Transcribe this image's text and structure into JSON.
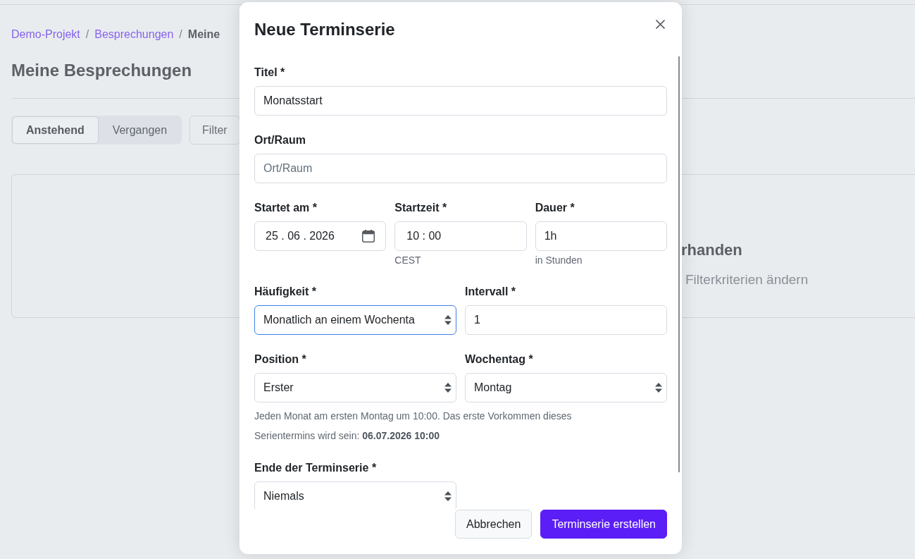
{
  "page": {
    "breadcrumb": [
      {
        "kind": "link",
        "label": "Demo-Projekt"
      },
      {
        "kind": "separator",
        "label": "/"
      },
      {
        "kind": "link",
        "label": "Besprechungen"
      },
      {
        "kind": "separator",
        "label": "/"
      },
      {
        "kind": "current",
        "label": "Meine"
      }
    ],
    "title": "Meine Besprechungen",
    "tabs": [
      {
        "label": "Anstehend",
        "selected": true
      },
      {
        "label": "Vergangen",
        "selected": false
      }
    ],
    "filter_button": "Filter",
    "empty_state": {
      "heading": "rhanden",
      "hint": "Filterkriterien ändern"
    }
  },
  "dialog": {
    "title": "Neue Terminserie",
    "sections": [
      {
        "kind": "full",
        "fields": [
          {
            "kind": "text",
            "label": "Titel *",
            "value": "Monatsstart",
            "focused": false
          }
        ]
      },
      {
        "kind": "full",
        "fields": [
          {
            "kind": "text",
            "label": "Ort/Raum",
            "placeholder": "Ort/Raum",
            "focused": false
          }
        ]
      },
      {
        "kind": "thirds",
        "fields": [
          {
            "kind": "date",
            "label": "Startet am *",
            "value": "25 . 06 . 2026",
            "focused": false
          },
          {
            "kind": "time",
            "label": "Startzeit *",
            "value": "10 : 00",
            "help": "CEST",
            "focused": false
          },
          {
            "kind": "text",
            "label": "Dauer *",
            "value": "1h",
            "help": "in Stunden",
            "focused": false
          }
        ]
      },
      {
        "kind": "halves",
        "fields": [
          {
            "kind": "select",
            "label": "Häufigkeit *",
            "value": "Monatlich an einem Wochenta",
            "focused": true
          },
          {
            "kind": "text",
            "label": "Intervall *",
            "value": "1",
            "focused": false
          }
        ]
      },
      {
        "kind": "halves",
        "fields": [
          {
            "kind": "select",
            "label": "Position *",
            "value": "Erster",
            "focused": false
          },
          {
            "kind": "select",
            "label": "Wochentag *",
            "value": "Montag",
            "focused": false
          }
        ]
      },
      {
        "kind": "note",
        "text": "Jeden Monat am ersten Montag um 10:00. Das erste Vorkommen dieses Serientermins wird sein: **06.07.2026 10:00**"
      },
      {
        "kind": "halves",
        "fields": [
          {
            "kind": "select",
            "label": "Ende der Terminserie *",
            "value": "Niemals",
            "focused": false
          }
        ]
      }
    ],
    "buttons": [
      {
        "label": "Abbrechen",
        "kind": "secondary"
      },
      {
        "label": "Terminserie erstellen",
        "kind": "primary"
      }
    ]
  }
}
